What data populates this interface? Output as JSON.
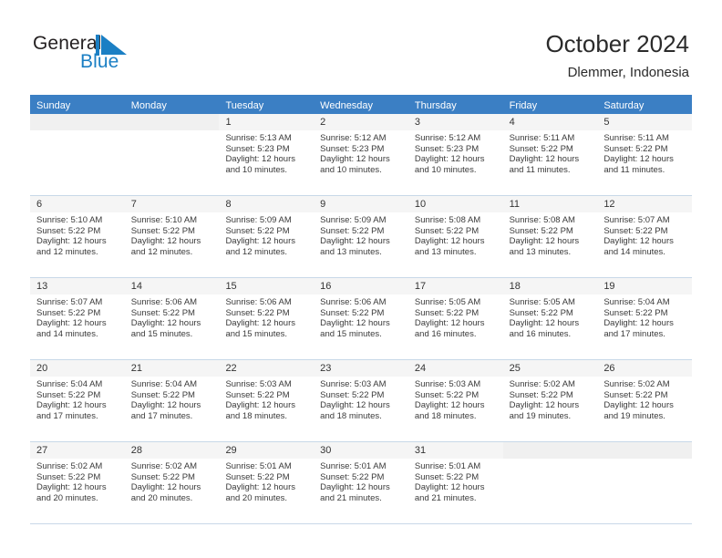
{
  "brand": {
    "name_top": "General",
    "name_bottom": "Blue",
    "accent_color": "#1b7fc4"
  },
  "header": {
    "title": "October 2024",
    "subtitle": "Dlemmer, Indonesia"
  },
  "colors": {
    "header_row_bg": "#3b7fc4",
    "header_row_text": "#ffffff",
    "daynum_bg": "#f5f5f5",
    "row_divider": "#c8d8e8"
  },
  "weekdays": [
    "Sunday",
    "Monday",
    "Tuesday",
    "Wednesday",
    "Thursday",
    "Friday",
    "Saturday"
  ],
  "weeks": [
    [
      {
        "day": "",
        "empty": true,
        "sunrise": "",
        "sunset": "",
        "daylight_1": "",
        "daylight_2": ""
      },
      {
        "day": "",
        "empty": true,
        "sunrise": "",
        "sunset": "",
        "daylight_1": "",
        "daylight_2": ""
      },
      {
        "day": "1",
        "sunrise": "Sunrise: 5:13 AM",
        "sunset": "Sunset: 5:23 PM",
        "daylight_1": "Daylight: 12 hours",
        "daylight_2": "and 10 minutes."
      },
      {
        "day": "2",
        "sunrise": "Sunrise: 5:12 AM",
        "sunset": "Sunset: 5:23 PM",
        "daylight_1": "Daylight: 12 hours",
        "daylight_2": "and 10 minutes."
      },
      {
        "day": "3",
        "sunrise": "Sunrise: 5:12 AM",
        "sunset": "Sunset: 5:23 PM",
        "daylight_1": "Daylight: 12 hours",
        "daylight_2": "and 10 minutes."
      },
      {
        "day": "4",
        "sunrise": "Sunrise: 5:11 AM",
        "sunset": "Sunset: 5:22 PM",
        "daylight_1": "Daylight: 12 hours",
        "daylight_2": "and 11 minutes."
      },
      {
        "day": "5",
        "sunrise": "Sunrise: 5:11 AM",
        "sunset": "Sunset: 5:22 PM",
        "daylight_1": "Daylight: 12 hours",
        "daylight_2": "and 11 minutes."
      }
    ],
    [
      {
        "day": "6",
        "sunrise": "Sunrise: 5:10 AM",
        "sunset": "Sunset: 5:22 PM",
        "daylight_1": "Daylight: 12 hours",
        "daylight_2": "and 12 minutes."
      },
      {
        "day": "7",
        "sunrise": "Sunrise: 5:10 AM",
        "sunset": "Sunset: 5:22 PM",
        "daylight_1": "Daylight: 12 hours",
        "daylight_2": "and 12 minutes."
      },
      {
        "day": "8",
        "sunrise": "Sunrise: 5:09 AM",
        "sunset": "Sunset: 5:22 PM",
        "daylight_1": "Daylight: 12 hours",
        "daylight_2": "and 12 minutes."
      },
      {
        "day": "9",
        "sunrise": "Sunrise: 5:09 AM",
        "sunset": "Sunset: 5:22 PM",
        "daylight_1": "Daylight: 12 hours",
        "daylight_2": "and 13 minutes."
      },
      {
        "day": "10",
        "sunrise": "Sunrise: 5:08 AM",
        "sunset": "Sunset: 5:22 PM",
        "daylight_1": "Daylight: 12 hours",
        "daylight_2": "and 13 minutes."
      },
      {
        "day": "11",
        "sunrise": "Sunrise: 5:08 AM",
        "sunset": "Sunset: 5:22 PM",
        "daylight_1": "Daylight: 12 hours",
        "daylight_2": "and 13 minutes."
      },
      {
        "day": "12",
        "sunrise": "Sunrise: 5:07 AM",
        "sunset": "Sunset: 5:22 PM",
        "daylight_1": "Daylight: 12 hours",
        "daylight_2": "and 14 minutes."
      }
    ],
    [
      {
        "day": "13",
        "sunrise": "Sunrise: 5:07 AM",
        "sunset": "Sunset: 5:22 PM",
        "daylight_1": "Daylight: 12 hours",
        "daylight_2": "and 14 minutes."
      },
      {
        "day": "14",
        "sunrise": "Sunrise: 5:06 AM",
        "sunset": "Sunset: 5:22 PM",
        "daylight_1": "Daylight: 12 hours",
        "daylight_2": "and 15 minutes."
      },
      {
        "day": "15",
        "sunrise": "Sunrise: 5:06 AM",
        "sunset": "Sunset: 5:22 PM",
        "daylight_1": "Daylight: 12 hours",
        "daylight_2": "and 15 minutes."
      },
      {
        "day": "16",
        "sunrise": "Sunrise: 5:06 AM",
        "sunset": "Sunset: 5:22 PM",
        "daylight_1": "Daylight: 12 hours",
        "daylight_2": "and 15 minutes."
      },
      {
        "day": "17",
        "sunrise": "Sunrise: 5:05 AM",
        "sunset": "Sunset: 5:22 PM",
        "daylight_1": "Daylight: 12 hours",
        "daylight_2": "and 16 minutes."
      },
      {
        "day": "18",
        "sunrise": "Sunrise: 5:05 AM",
        "sunset": "Sunset: 5:22 PM",
        "daylight_1": "Daylight: 12 hours",
        "daylight_2": "and 16 minutes."
      },
      {
        "day": "19",
        "sunrise": "Sunrise: 5:04 AM",
        "sunset": "Sunset: 5:22 PM",
        "daylight_1": "Daylight: 12 hours",
        "daylight_2": "and 17 minutes."
      }
    ],
    [
      {
        "day": "20",
        "sunrise": "Sunrise: 5:04 AM",
        "sunset": "Sunset: 5:22 PM",
        "daylight_1": "Daylight: 12 hours",
        "daylight_2": "and 17 minutes."
      },
      {
        "day": "21",
        "sunrise": "Sunrise: 5:04 AM",
        "sunset": "Sunset: 5:22 PM",
        "daylight_1": "Daylight: 12 hours",
        "daylight_2": "and 17 minutes."
      },
      {
        "day": "22",
        "sunrise": "Sunrise: 5:03 AM",
        "sunset": "Sunset: 5:22 PM",
        "daylight_1": "Daylight: 12 hours",
        "daylight_2": "and 18 minutes."
      },
      {
        "day": "23",
        "sunrise": "Sunrise: 5:03 AM",
        "sunset": "Sunset: 5:22 PM",
        "daylight_1": "Daylight: 12 hours",
        "daylight_2": "and 18 minutes."
      },
      {
        "day": "24",
        "sunrise": "Sunrise: 5:03 AM",
        "sunset": "Sunset: 5:22 PM",
        "daylight_1": "Daylight: 12 hours",
        "daylight_2": "and 18 minutes."
      },
      {
        "day": "25",
        "sunrise": "Sunrise: 5:02 AM",
        "sunset": "Sunset: 5:22 PM",
        "daylight_1": "Daylight: 12 hours",
        "daylight_2": "and 19 minutes."
      },
      {
        "day": "26",
        "sunrise": "Sunrise: 5:02 AM",
        "sunset": "Sunset: 5:22 PM",
        "daylight_1": "Daylight: 12 hours",
        "daylight_2": "and 19 minutes."
      }
    ],
    [
      {
        "day": "27",
        "sunrise": "Sunrise: 5:02 AM",
        "sunset": "Sunset: 5:22 PM",
        "daylight_1": "Daylight: 12 hours",
        "daylight_2": "and 20 minutes."
      },
      {
        "day": "28",
        "sunrise": "Sunrise: 5:02 AM",
        "sunset": "Sunset: 5:22 PM",
        "daylight_1": "Daylight: 12 hours",
        "daylight_2": "and 20 minutes."
      },
      {
        "day": "29",
        "sunrise": "Sunrise: 5:01 AM",
        "sunset": "Sunset: 5:22 PM",
        "daylight_1": "Daylight: 12 hours",
        "daylight_2": "and 20 minutes."
      },
      {
        "day": "30",
        "sunrise": "Sunrise: 5:01 AM",
        "sunset": "Sunset: 5:22 PM",
        "daylight_1": "Daylight: 12 hours",
        "daylight_2": "and 21 minutes."
      },
      {
        "day": "31",
        "sunrise": "Sunrise: 5:01 AM",
        "sunset": "Sunset: 5:22 PM",
        "daylight_1": "Daylight: 12 hours",
        "daylight_2": "and 21 minutes."
      },
      {
        "day": "",
        "empty": true,
        "sunrise": "",
        "sunset": "",
        "daylight_1": "",
        "daylight_2": ""
      },
      {
        "day": "",
        "empty": true,
        "sunrise": "",
        "sunset": "",
        "daylight_1": "",
        "daylight_2": ""
      }
    ]
  ]
}
